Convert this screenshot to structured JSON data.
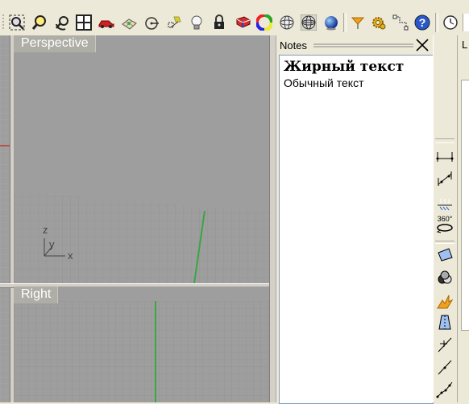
{
  "viewports": {
    "perspective": "Perspective",
    "right": "Right"
  },
  "axes": {
    "z": "z",
    "y": "y",
    "x": "x"
  },
  "notes": {
    "title": "Notes",
    "bold_text": "Жирный текст",
    "normal_text": "Обычный текст"
  },
  "right_toolbar": {
    "rotate_label": "360°"
  },
  "far_panel": {
    "label": "L"
  },
  "toolbar_icons": [
    "zoom-extents-icon",
    "zoom-window-icon",
    "rotate-view-icon",
    "four-viewports-icon",
    "car-icon",
    "grid-plane-icon",
    "arrow-circle-icon",
    "light-icon",
    "bulb-icon",
    "lock-icon",
    "book-icon",
    "color-wheel-icon",
    "wireframe-sphere-icon",
    "mesh-sphere-icon",
    "shaded-sphere-icon",
    "flag-icon",
    "gear-icon",
    "dimension-icon",
    "help-icon",
    "clock-icon"
  ],
  "colors": {
    "grid_axis_green": "#3aa544",
    "grid_axis_red": "#c0392b",
    "viewport_bg": "#9e9e9e"
  }
}
